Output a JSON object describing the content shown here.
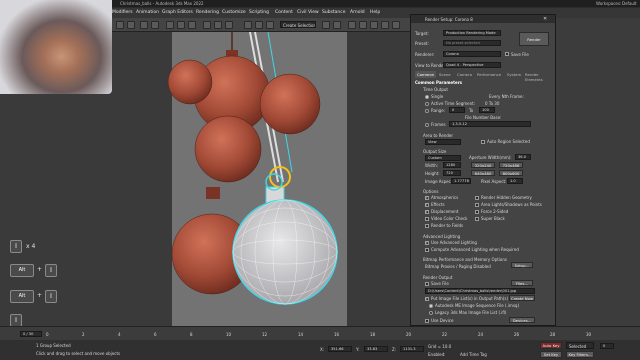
{
  "window": {
    "title": "Christmas_balls - Autodesk 3ds Max 2022",
    "workspace_label": "Workspaces:",
    "workspace_value": "Default"
  },
  "menu": [
    "File",
    "Edit",
    "Tools",
    "Group",
    "Views",
    "Create",
    "Modifiers",
    "Animation",
    "Graph Editors",
    "Rendering",
    "Customize",
    "Scripting",
    "Content",
    "Civil View",
    "Substance",
    "Arnold",
    "Help"
  ],
  "toolbar": {
    "selection_set": "Create Selection Set"
  },
  "shortcuts": {
    "row1_count": "x 4",
    "alt_label": "Alt",
    "plus": "+"
  },
  "render_dialog": {
    "title": "Render Setup: Corona 8",
    "target_label": "Target:",
    "target_value": "Production Rendering Mode",
    "preset_label": "Preset:",
    "preset_value": "No preset selected",
    "renderer_label": "Renderer:",
    "renderer_value": "Corona",
    "save_file_label": "Save File",
    "render_button": "Render",
    "view_label": "View to Render:",
    "view_value": "Quad 4 - Perspective",
    "tabs": [
      "Common",
      "Scene",
      "Camera",
      "Performance",
      "System",
      "Render Elements"
    ],
    "common_params": "Common Parameters",
    "time_output": "Time Output",
    "single": "Single",
    "every_nth": "Every Nth Frame:",
    "active_segment": "Active Time Segment:",
    "active_segment_range": "0 To 30",
    "range_label": "Range:",
    "range_from": "0",
    "range_to": "To",
    "range_end": "100",
    "file_number_base": "File Number Base:",
    "frames_label": "Frames",
    "frames_value": "1,3,5-12",
    "area_to_render": "Area to Render",
    "area_value": "View",
    "auto_region": "Auto Region Selected",
    "output_size": "Output Size",
    "output_size_value": "Custom",
    "aperture_label": "Aperture Width(mm):",
    "aperture_value": "36.0",
    "width_label": "Width:",
    "width_value": "1280",
    "height_label": "Height:",
    "height_value": "720",
    "res_buttons": [
      "320x240",
      "720x486",
      "640x480",
      "800x600"
    ],
    "image_aspect_label": "Image Aspect:",
    "image_aspect_value": "1.77778",
    "pixel_aspect_label": "Pixel Aspect:",
    "pixel_aspect_value": "1.0",
    "options": "Options",
    "opt_atmospherics": "Atmospherics",
    "opt_effects": "Effects",
    "opt_displacement": "Displacement",
    "opt_video_color": "Video Color Check",
    "opt_render_fields": "Render to Fields",
    "opt_hidden_geo": "Render Hidden Geometry",
    "opt_area_lights": "Area Lights/Shadows as Points",
    "opt_force_2sided": "Force 2-Sided",
    "opt_super_black": "Super Black",
    "advanced_lighting": "Advanced Lighting",
    "use_adv_lighting": "Use Advanced Lighting",
    "compute_adv_lighting": "Compute Advanced Lighting when Required",
    "bitmap_perf": "Bitmap Performance and Memory Options",
    "bitmap_proxies": "Bitmap Proxies / Paging Disabled",
    "setup_button": "Setup...",
    "render_output": "Render Output",
    "save_file": "Save File",
    "files_button": "Files...",
    "output_path": "D:\\Users\\Content\\Christmas_balls\\render\\001.jpg",
    "put_image_list": "Put Image File List(s) in Output Path(s)",
    "create_now": "Create Now",
    "autodesk_me": "Autodesk ME Image Sequence File (.imsq)",
    "legacy": "Legacy 3ds Max Image File List (.ifl)",
    "use_device": "Use Device",
    "devices_button": "Devices..."
  },
  "timeline": {
    "frame_readout": "0 / 30",
    "ticks": [
      "0",
      "2",
      "4",
      "6",
      "8",
      "10",
      "12",
      "14",
      "16",
      "18",
      "20",
      "22",
      "24",
      "26",
      "28",
      "30"
    ]
  },
  "status": {
    "selected": "1 Group Selected",
    "hint": "Click and drag to select and move objects",
    "x_label": "X:",
    "x_value": "351.66",
    "y_label": "Y:",
    "y_value": "33.83",
    "z_label": "Z:",
    "z_value": "1131.3",
    "grid_label": "Grid = 10.0",
    "enabled_label": "Enabled:",
    "add_time_tag": "Add Time Tag",
    "auto_key": "Auto Key",
    "set_key": "Set Key",
    "selected_dd": "Selected",
    "key_filters": "Key Filters...",
    "frame_field": "0"
  },
  "colors": {
    "ornament": "#b35a46",
    "ornament_dark": "#7a3325",
    "wire": "#d8d8d8",
    "select_cyan": "#3fd6e6",
    "gizmo_yellow": "#f2c021"
  }
}
